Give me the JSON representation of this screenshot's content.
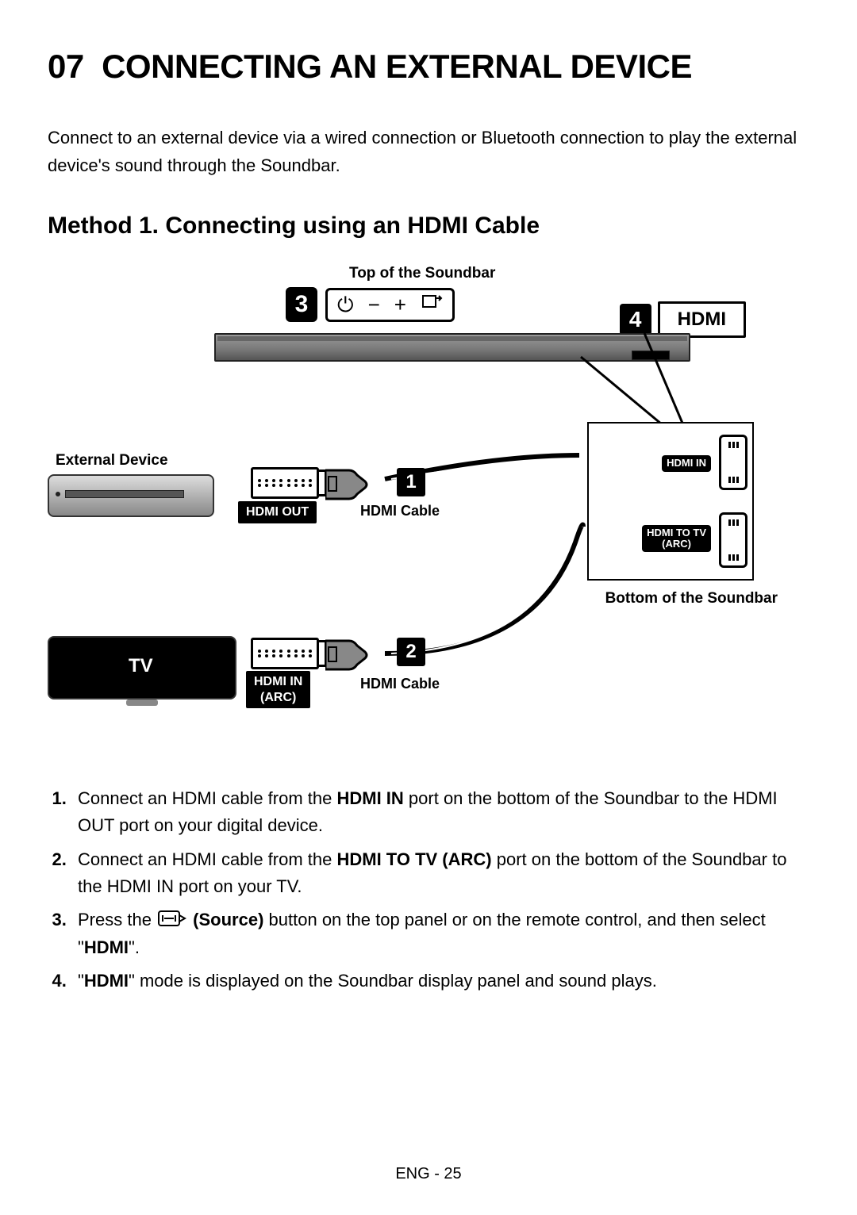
{
  "section_number": "07",
  "section_title": "CONNECTING AN EXTERNAL DEVICE",
  "intro": "Connect to an external device via a wired connection or Bluetooth connection to play the external device's sound through the Soundbar.",
  "method_heading": "Method 1. Connecting using an HDMI Cable",
  "diagram": {
    "top_label": "Top of the Soundbar",
    "hdmi_bubble": "HDMI",
    "external_device_label": "External Device",
    "bottom_label": "Bottom of the Soundbar",
    "tv_label": "TV",
    "port_hdmi_in": "HDMI IN",
    "port_hdmi_to_tv": "HDMI TO TV\n(ARC)",
    "tag_hdmi_out": "HDMI OUT",
    "tag_hdmi_in_arc_line1": "HDMI IN",
    "tag_hdmi_in_arc_line2": "(ARC)",
    "cable_label": "HDMI Cable",
    "callouts": {
      "c1": "1",
      "c2": "2",
      "c3": "3",
      "c4": "4"
    },
    "top_panel": {
      "power_sym": "⏻",
      "minus_sym": "−",
      "plus_sym": "+"
    }
  },
  "steps": {
    "s1_pre": "Connect an HDMI cable from the ",
    "s1_bold": "HDMI IN",
    "s1_post": " port on the bottom of the Soundbar to the HDMI OUT port on your digital device.",
    "s2_pre": "Connect an HDMI cable from the ",
    "s2_bold": "HDMI TO TV (ARC)",
    "s2_post": " port on the bottom of the Soundbar to the HDMI IN port on your TV.",
    "s3_pre": "Press the ",
    "s3_bold": "(Source)",
    "s3_mid": " button on the top panel or on the remote control, and then select \"",
    "s3_hdmi": "HDMI",
    "s3_end": "\".",
    "s4_pre": "\"",
    "s4_hdmi": "HDMI",
    "s4_post": "\" mode is displayed on the Soundbar display panel and sound plays."
  },
  "page_footer": "ENG - 25"
}
